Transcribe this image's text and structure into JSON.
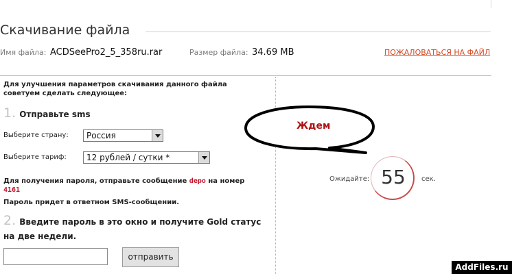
{
  "header": {
    "title": "Скачивание файла"
  },
  "file": {
    "name_label": "Имя файла:",
    "name": "ACDSeePro2_5_358ru.rar",
    "size_label": "Размер файла:",
    "size": "34.69 MB",
    "report_link": "ПОЖАЛОВАТЬСЯ НА ФАЙЛ"
  },
  "left": {
    "intro_line1": "Для улучшения параметров скачивания данного файла",
    "intro_line2": "советуем сделать следующее:",
    "step1_num": "1.",
    "step1_text": "Отправьте sms",
    "country_label": "Выберите страну:",
    "country_value": "Россия",
    "tariff_label": "Выберите тариф:",
    "tariff_value": "12 рублей / сутки *",
    "sms_text_a": "Для получения пароля, отправьте сообщение",
    "sms_code": "depo",
    "sms_text_b": "на номер",
    "sms_number": "4161",
    "sms_note": "Пароль придет в ответном SMS-сообщении.",
    "step2_num": "2.",
    "step2_line1": "Введите пароль в это окно и получите Gold статус",
    "step2_line2": "на две недели.",
    "password_value": "",
    "submit_label": "отправить"
  },
  "right": {
    "bubble_text": "Ждем",
    "wait_label": "Ожидайте:",
    "countdown": "55",
    "sec_label": "сек."
  },
  "watermark": "AddFiles.ru"
}
